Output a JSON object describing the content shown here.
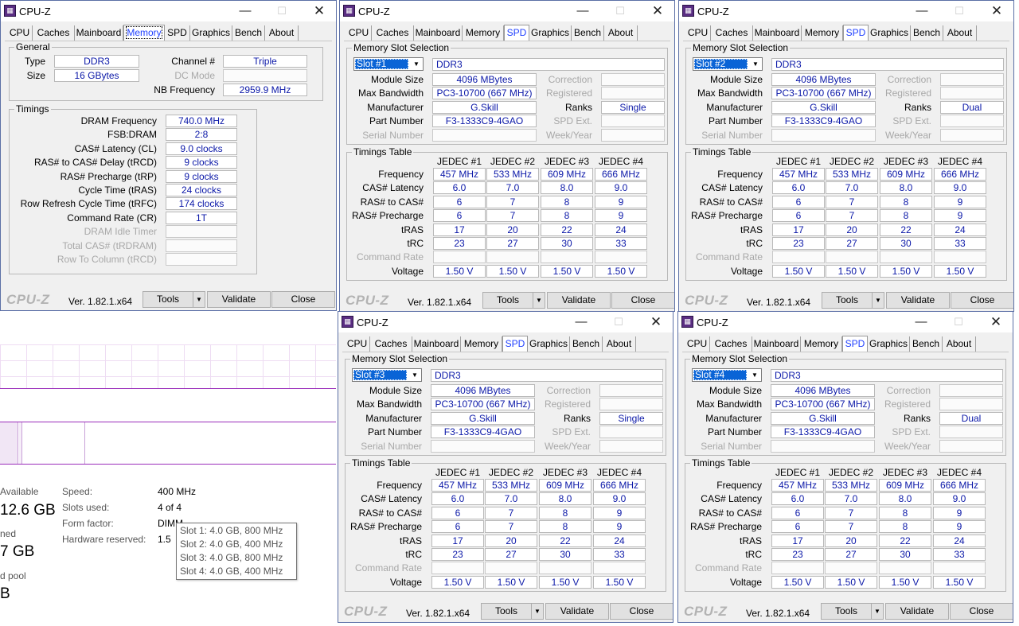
{
  "taskmgr": {
    "available_label": "Available",
    "available_value": "12.6 GB",
    "committed_label": "ned",
    "committed_value": "7 GB",
    "pool_label": "d pool",
    "pool_value": "B",
    "speed_label": "Speed:",
    "speed_value": "400 MHz",
    "slots_label": "Slots used:",
    "slots_value": "4 of 4",
    "form_label": "Form factor:",
    "form_value": "DIMM",
    "reserved_label": "Hardware reserved:",
    "reserved_value": "1.5",
    "tooltip": [
      "Slot 1: 4.0 GB, 800 MHz",
      "Slot 2: 4.0 GB, 400 MHz",
      "Slot 3: 4.0 GB, 800 MHz",
      "Slot 4: 4.0 GB, 400 MHz"
    ]
  },
  "common": {
    "title": "CPU-Z",
    "minimize": "—",
    "maximize": "☐",
    "close_glyph": "✕",
    "tabs": [
      "CPU",
      "Caches",
      "Mainboard",
      "Memory",
      "SPD",
      "Graphics",
      "Bench",
      "About"
    ],
    "brand": "CPU-Z",
    "version": "Ver. 1.82.1.x64",
    "tools": "Tools",
    "validate": "Validate",
    "close": "Close",
    "dropdown_arrow": "▼"
  },
  "memory": {
    "general_label": "General",
    "type_label": "Type",
    "type_value": "DDR3",
    "size_label": "Size",
    "size_value": "16 GBytes",
    "channel_label": "Channel #",
    "channel_value": "Triple",
    "dc_label": "DC Mode",
    "dc_value": "",
    "nb_label": "NB Frequency",
    "nb_value": "2959.9 MHz",
    "timings_label": "Timings",
    "timings": [
      {
        "label": "DRAM Frequency",
        "value": "740.0 MHz",
        "dim": false
      },
      {
        "label": "FSB:DRAM",
        "value": "2:8",
        "dim": false
      },
      {
        "label": "CAS# Latency (CL)",
        "value": "9.0 clocks",
        "dim": false
      },
      {
        "label": "RAS# to CAS# Delay (tRCD)",
        "value": "9 clocks",
        "dim": false
      },
      {
        "label": "RAS# Precharge (tRP)",
        "value": "9 clocks",
        "dim": false
      },
      {
        "label": "Cycle Time (tRAS)",
        "value": "24 clocks",
        "dim": false
      },
      {
        "label": "Row Refresh Cycle Time (tRFC)",
        "value": "174 clocks",
        "dim": false
      },
      {
        "label": "Command Rate (CR)",
        "value": "1T",
        "dim": false
      },
      {
        "label": "DRAM Idle Timer",
        "value": "",
        "dim": true
      },
      {
        "label": "Total CAS# (tRDRAM)",
        "value": "",
        "dim": true
      },
      {
        "label": "Row To Column (tRCD)",
        "value": "",
        "dim": true
      }
    ]
  },
  "spd_labels": {
    "slot_selection": "Memory Slot Selection",
    "module_size": "Module Size",
    "max_bandwidth": "Max Bandwidth",
    "manufacturer": "Manufacturer",
    "part_number": "Part Number",
    "serial_number": "Serial Number",
    "correction": "Correction",
    "registered": "Registered",
    "ranks": "Ranks",
    "spd_ext": "SPD Ext.",
    "week_year": "Week/Year",
    "timings_table": "Timings Table",
    "jedec": [
      "JEDEC #1",
      "JEDEC #2",
      "JEDEC #3",
      "JEDEC #4"
    ],
    "rows": [
      "Frequency",
      "CAS# Latency",
      "RAS# to CAS#",
      "RAS# Precharge",
      "tRAS",
      "tRC",
      "Command Rate",
      "Voltage"
    ]
  },
  "spd_table": {
    "Frequency": [
      "457 MHz",
      "533 MHz",
      "609 MHz",
      "666 MHz"
    ],
    "CAS# Latency": [
      "6.0",
      "7.0",
      "8.0",
      "9.0"
    ],
    "RAS# to CAS#": [
      "6",
      "7",
      "8",
      "9"
    ],
    "RAS# Precharge": [
      "6",
      "7",
      "8",
      "9"
    ],
    "tRAS": [
      "17",
      "20",
      "22",
      "24"
    ],
    "tRC": [
      "23",
      "27",
      "30",
      "33"
    ],
    "Command Rate": [
      "",
      "",
      "",
      ""
    ],
    "Voltage": [
      "1.50 V",
      "1.50 V",
      "1.50 V",
      "1.50 V"
    ]
  },
  "spd_slots": [
    {
      "slot": "Slot #1",
      "type": "DDR3",
      "module_size": "4096 MBytes",
      "max_bandwidth": "PC3-10700 (667 MHz)",
      "manufacturer": "G.Skill",
      "part_number": "F3-1333C9-4GAO",
      "ranks": "Single"
    },
    {
      "slot": "Slot #2",
      "type": "DDR3",
      "module_size": "4096 MBytes",
      "max_bandwidth": "PC3-10700 (667 MHz)",
      "manufacturer": "G.Skill",
      "part_number": "F3-1333C9-4GAO",
      "ranks": "Dual"
    },
    {
      "slot": "Slot #3",
      "type": "DDR3",
      "module_size": "4096 MBytes",
      "max_bandwidth": "PC3-10700 (667 MHz)",
      "manufacturer": "G.Skill",
      "part_number": "F3-1333C9-4GAO",
      "ranks": "Single"
    },
    {
      "slot": "Slot #4",
      "type": "DDR3",
      "module_size": "4096 MBytes",
      "max_bandwidth": "PC3-10700 (667 MHz)",
      "manufacturer": "G.Skill",
      "part_number": "F3-1333C9-4GAO",
      "ranks": "Dual"
    }
  ]
}
